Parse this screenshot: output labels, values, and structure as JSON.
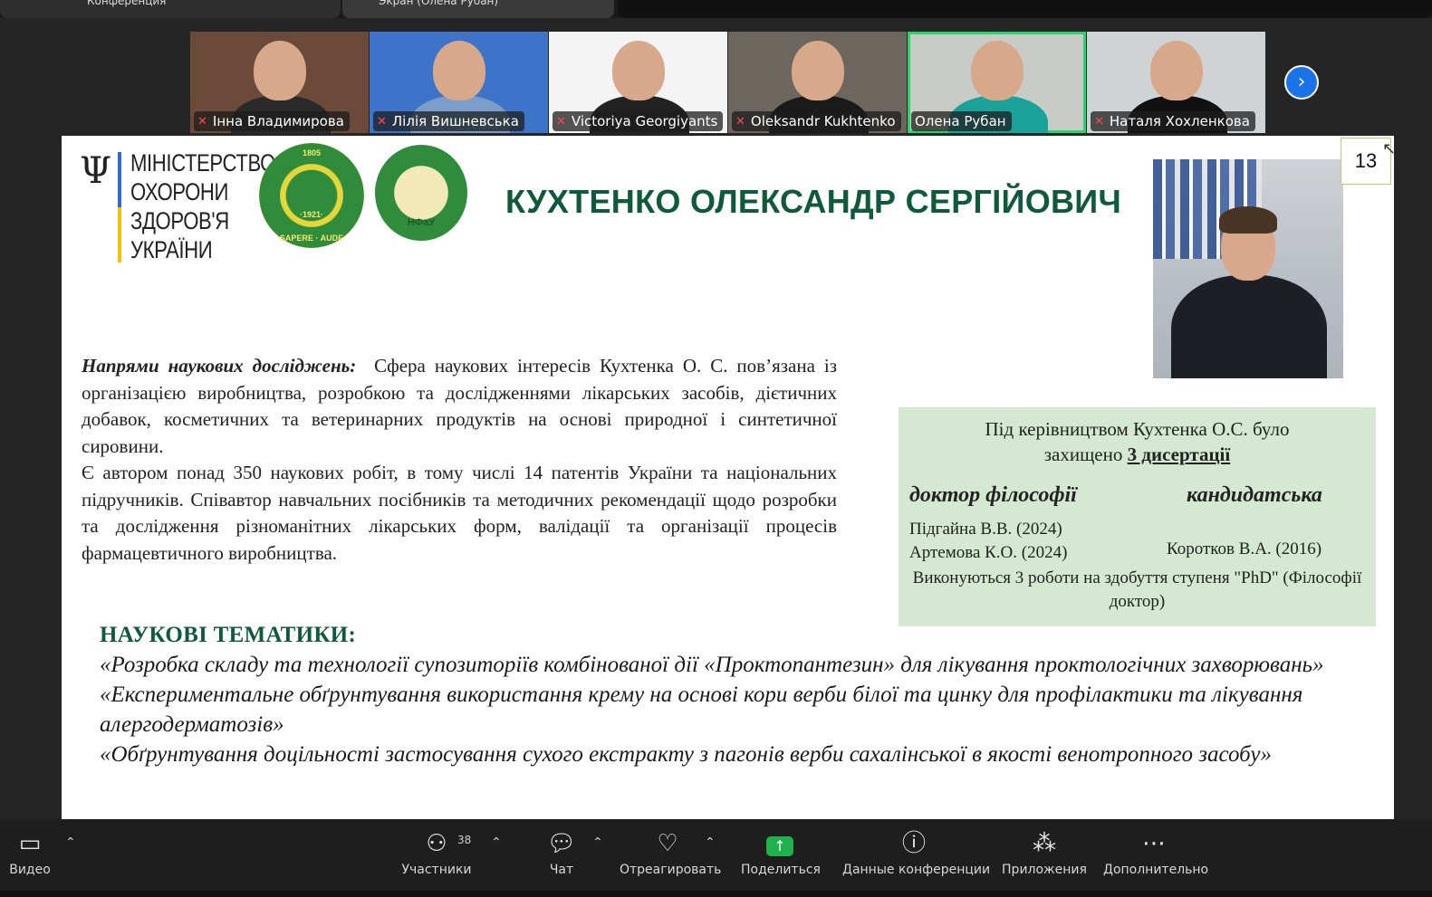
{
  "tabs": {
    "left": "Конференция",
    "middle": "Экран (Олена Рубан)"
  },
  "participants": [
    {
      "name": "Інна Владимирова",
      "muted": true,
      "bg": "#6b4a3a",
      "body": "#2a2a2a"
    },
    {
      "name": "Лілія Вишневська",
      "muted": true,
      "bg": "#3d73c9",
      "body": "#7a9ec9"
    },
    {
      "name": "Victoriya Georgiyants",
      "muted": true,
      "bg": "#f4f4f4",
      "body": "#222222"
    },
    {
      "name": "Oleksandr Kukhtenko",
      "muted": true,
      "bg": "#6d665e",
      "body": "#1a1a1a"
    },
    {
      "name": "Олена Рубан",
      "muted": false,
      "bg": "#c9cbc7",
      "body": "#1aa39b"
    },
    {
      "name": "Наталя Хохленкова",
      "muted": true,
      "bg": "#cfd3d6",
      "body": "#111111"
    }
  ],
  "slide": {
    "ministry_lines": [
      "МІНІСТЕРСТВО",
      "ОХОРОНИ",
      "ЗДОРОВ'Я",
      "УКРАЇНИ"
    ],
    "seal1_top": "1805",
    "seal1_bottom": "SAPERE · AUDE",
    "seal1_year": "·1921·",
    "seal2_text": "НФаУ",
    "person_name": "КУХТЕНКО ОЛЕКСАНДР СЕРГІЙОВИЧ",
    "page_number": "13",
    "research_lead": "Напрями наукових досліджень:",
    "research_text": "Сфера наукових інтересів Кухтенка О. С. пов’язана із організацією виробництва, розробкою та дослідженнями лікарських засобів, дієтичних добавок, косметичних та ветеринарних продуктів на основі природної і синтетичної сировини.",
    "research_text2": "Є автором понад 350 наукових робіт, в тому числі 14 патентів України та національних підручників. Співавтор навчальних посібників та методичних рекомендації щодо розробки та дослідження різноманітних лікарських форм, валідації та організації процесів фармацевтичного виробництва.",
    "supervision": {
      "line1": "Під керівництвом Кухтенка О.С. було",
      "line2_prefix": "захищено ",
      "line2_bold": "3 дисертації",
      "col1_title": "доктор філософії",
      "col2_title": "кандидатська",
      "col1_items": [
        "Підгайна В.В. (2024)",
        "Артемова К.О. (2024)"
      ],
      "col2_items": [
        "Коротков В.А. (2016)"
      ],
      "footer": "Виконуються 3 роботи на здобуття ступеня \"PhD\" (Філософії доктор)"
    },
    "themes_title": "НАУКОВІ ТЕМАТИКИ:",
    "themes": [
      "«Розробка складу та технології супозиторіїв комбінованої дії «Проктопантезин» для лікування проктологічних захворювань»",
      "«Експериментальне обґрунтування використання крему на основі кори верби білої та цинку для профілактики та лікування алергодерматозів»",
      "«Обґрунтування доцільності застосування сухого екстракту з пагонів верби сахалінської в якості венотропного засобу»"
    ]
  },
  "toolbar": {
    "video": "Видео",
    "participants": "Участники",
    "participants_count": "38",
    "chat": "Чат",
    "react": "Отреагировать",
    "share": "Поделиться",
    "info": "Данные конференции",
    "apps": "Приложения",
    "more": "Дополнительно"
  },
  "colors": {
    "accent_green": "#2ad36b",
    "title_green": "#0f5a3a",
    "box_green": "#d5e8d1",
    "share_green": "#1fb14b",
    "next_blue": "#1a73e8"
  }
}
